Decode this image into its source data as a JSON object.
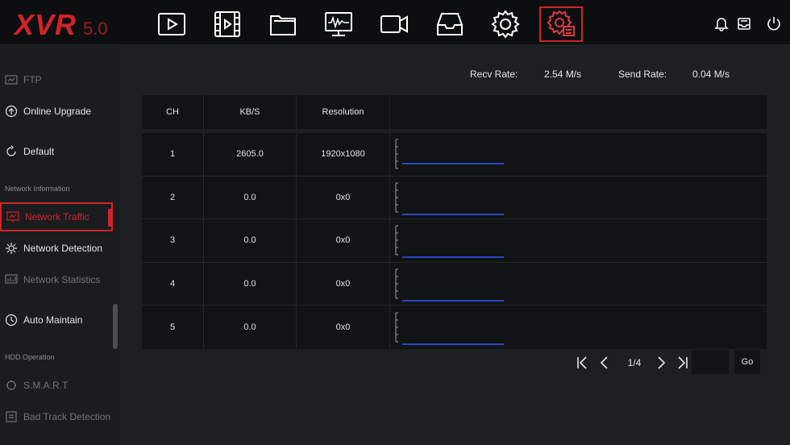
{
  "app": {
    "brand": "XVR",
    "version": "5.0"
  },
  "topnav": {
    "icons": [
      "playback-icon",
      "video-list-icon",
      "folder-icon",
      "monitor-icon",
      "camera-icon",
      "storage-icon",
      "settings-gear-icon",
      "system-settings-icon"
    ],
    "active": "system-settings-icon",
    "right_icons": [
      "bell-icon",
      "disk-icon",
      "power-icon"
    ]
  },
  "sidebar": {
    "items": [
      {
        "label": "FTP",
        "icon": "ftp-icon",
        "state": "dim"
      },
      {
        "label": "Online Upgrade",
        "icon": "upgrade-icon",
        "state": "normal"
      },
      {
        "label": "Default",
        "icon": "default-icon",
        "state": "normal"
      },
      {
        "label": "Network Traffic",
        "icon": "network-traffic-icon",
        "state": "active"
      },
      {
        "label": "Network Detection",
        "icon": "network-detection-icon",
        "state": "normal"
      },
      {
        "label": "Network Statistics",
        "icon": "network-statistics-icon",
        "state": "dim"
      },
      {
        "label": "Auto Maintain",
        "icon": "auto-maintain-icon",
        "state": "normal"
      },
      {
        "label": "S.M.A.R.T",
        "icon": "smart-icon",
        "state": "dim"
      },
      {
        "label": "Bad Track Detection",
        "icon": "bad-track-icon",
        "state": "dim"
      }
    ],
    "headers": {
      "network_information": "Network Information",
      "hdd_operation": "HDD Operation"
    }
  },
  "rates": {
    "recv_label": "Recv Rate:",
    "recv_value": "2.54 M/s",
    "send_label": "Send Rate:",
    "send_value": "0.04 M/s"
  },
  "table": {
    "headers": [
      "CH",
      "KB/S",
      "Resolution",
      ""
    ],
    "rows": [
      {
        "ch": "1",
        "kbs": "2605.0",
        "res": "1920x1080"
      },
      {
        "ch": "2",
        "kbs": "0.0",
        "res": "0x0"
      },
      {
        "ch": "3",
        "kbs": "0.0",
        "res": "0x0"
      },
      {
        "ch": "4",
        "kbs": "0.0",
        "res": "0x0"
      },
      {
        "ch": "5",
        "kbs": "0.0",
        "res": "0x0"
      }
    ]
  },
  "pager": {
    "page": "1/4",
    "go_label": "Go",
    "page_input": ""
  },
  "colors": {
    "accent": "#d2232a",
    "graph_line": "#2f5bff"
  }
}
